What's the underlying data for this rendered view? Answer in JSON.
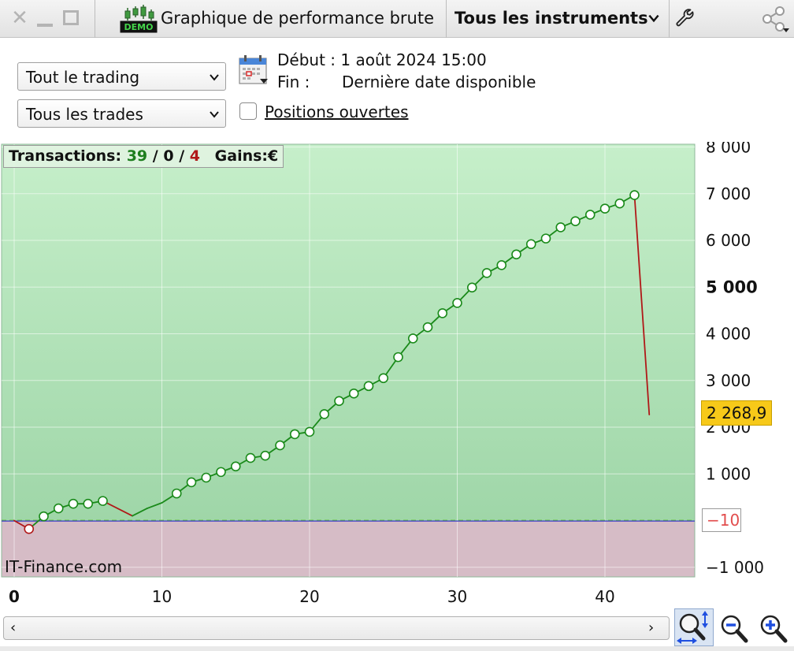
{
  "window": {
    "title": "Graphique de performance brute",
    "close_glyph": "✕",
    "demo_icon": "candlestick-demo-icon",
    "demo_icon_text": "DEMO",
    "instrument_select": "Tous les instruments",
    "settings_icon": "wrench-icon",
    "share_icon": "share-icon"
  },
  "controls": {
    "trading_select": "Tout le trading",
    "trades_select": "Tous les trades",
    "calendar_icon": "calendar-icon",
    "start_label": "Début :",
    "start_value": "1 août 2024 15:00",
    "end_label": "Fin :",
    "end_value": "Dernière date disponible",
    "open_positions_label": "Positions ouvertes",
    "open_positions_checked": false
  },
  "stats": {
    "transactions_label": "Transactions:",
    "wins": "39",
    "separator": "/",
    "neutral": "0",
    "losses": "4",
    "gains_label": "Gains:",
    "currency": "€"
  },
  "watermark": "IT-Finance.com",
  "last_value_label": "2 268,9",
  "reference_label": "−10",
  "colors": {
    "up_line": "#1a8a1a",
    "down_line": "#b01818",
    "positive_area": "#c6ecc8",
    "negative_area": "#d6bcc6",
    "last_badge": "#f7c919",
    "baseline": "#3a3ac8",
    "reference_dash": "#6ec24a"
  },
  "chart_data": {
    "type": "line",
    "xlabel": "",
    "ylabel": "",
    "xlim": [
      0,
      46
    ],
    "ylim": [
      -1250,
      8250
    ],
    "x_ticks": [
      0,
      10,
      20,
      30,
      40
    ],
    "x_tick_labels": [
      "0",
      "10",
      "20",
      "30",
      "40"
    ],
    "y_ticks": [
      8000,
      7000,
      6000,
      5000,
      4000,
      3000,
      2000,
      1000,
      -1000
    ],
    "y_tick_labels": [
      "8 000",
      "7 000",
      "6 000",
      "5 000",
      "4 000",
      "3 000",
      "2 000",
      "1 000",
      "−1 000"
    ],
    "bold_y_tick": 5000,
    "grid": true,
    "reference_value": -10,
    "last_value": 2268.9,
    "points": [
      {
        "x": 0,
        "y": 0,
        "marker": false
      },
      {
        "x": 1,
        "y": -180,
        "marker": true
      },
      {
        "x": 2,
        "y": 90,
        "marker": true
      },
      {
        "x": 3,
        "y": 260,
        "marker": true
      },
      {
        "x": 4,
        "y": 360,
        "marker": true
      },
      {
        "x": 5,
        "y": 360,
        "marker": true
      },
      {
        "x": 6,
        "y": 420,
        "marker": true
      },
      {
        "x": 8,
        "y": 100,
        "marker": false
      },
      {
        "x": 9,
        "y": 260,
        "marker": false
      },
      {
        "x": 10,
        "y": 380,
        "marker": false
      },
      {
        "x": 11,
        "y": 580,
        "marker": true
      },
      {
        "x": 12,
        "y": 820,
        "marker": true
      },
      {
        "x": 13,
        "y": 920,
        "marker": true
      },
      {
        "x": 14,
        "y": 1040,
        "marker": true
      },
      {
        "x": 15,
        "y": 1160,
        "marker": true
      },
      {
        "x": 16,
        "y": 1340,
        "marker": true
      },
      {
        "x": 17,
        "y": 1390,
        "marker": true
      },
      {
        "x": 18,
        "y": 1610,
        "marker": true
      },
      {
        "x": 19,
        "y": 1850,
        "marker": true
      },
      {
        "x": 20,
        "y": 1900,
        "marker": true
      },
      {
        "x": 21,
        "y": 2280,
        "marker": true
      },
      {
        "x": 22,
        "y": 2560,
        "marker": true
      },
      {
        "x": 23,
        "y": 2720,
        "marker": true
      },
      {
        "x": 24,
        "y": 2880,
        "marker": true
      },
      {
        "x": 25,
        "y": 3050,
        "marker": true
      },
      {
        "x": 26,
        "y": 3500,
        "marker": true
      },
      {
        "x": 27,
        "y": 3900,
        "marker": true
      },
      {
        "x": 28,
        "y": 4140,
        "marker": true
      },
      {
        "x": 29,
        "y": 4440,
        "marker": true
      },
      {
        "x": 30,
        "y": 4660,
        "marker": true
      },
      {
        "x": 31,
        "y": 4990,
        "marker": true
      },
      {
        "x": 32,
        "y": 5300,
        "marker": true
      },
      {
        "x": 33,
        "y": 5470,
        "marker": true
      },
      {
        "x": 34,
        "y": 5700,
        "marker": true
      },
      {
        "x": 35,
        "y": 5920,
        "marker": true
      },
      {
        "x": 36,
        "y": 6040,
        "marker": true
      },
      {
        "x": 37,
        "y": 6280,
        "marker": true
      },
      {
        "x": 38,
        "y": 6410,
        "marker": true
      },
      {
        "x": 39,
        "y": 6550,
        "marker": true
      },
      {
        "x": 40,
        "y": 6680,
        "marker": true
      },
      {
        "x": 41,
        "y": 6790,
        "marker": true
      },
      {
        "x": 42,
        "y": 6970,
        "marker": true
      },
      {
        "x": 43,
        "y": 2268.9,
        "marker": false
      }
    ]
  },
  "bottom_bar": {
    "scroll_left": "‹",
    "scroll_right": "›",
    "zoom_fit_icon": "zoom-fit-icon",
    "zoom_out_icon": "zoom-out-icon",
    "zoom_in_icon": "zoom-in-icon"
  }
}
